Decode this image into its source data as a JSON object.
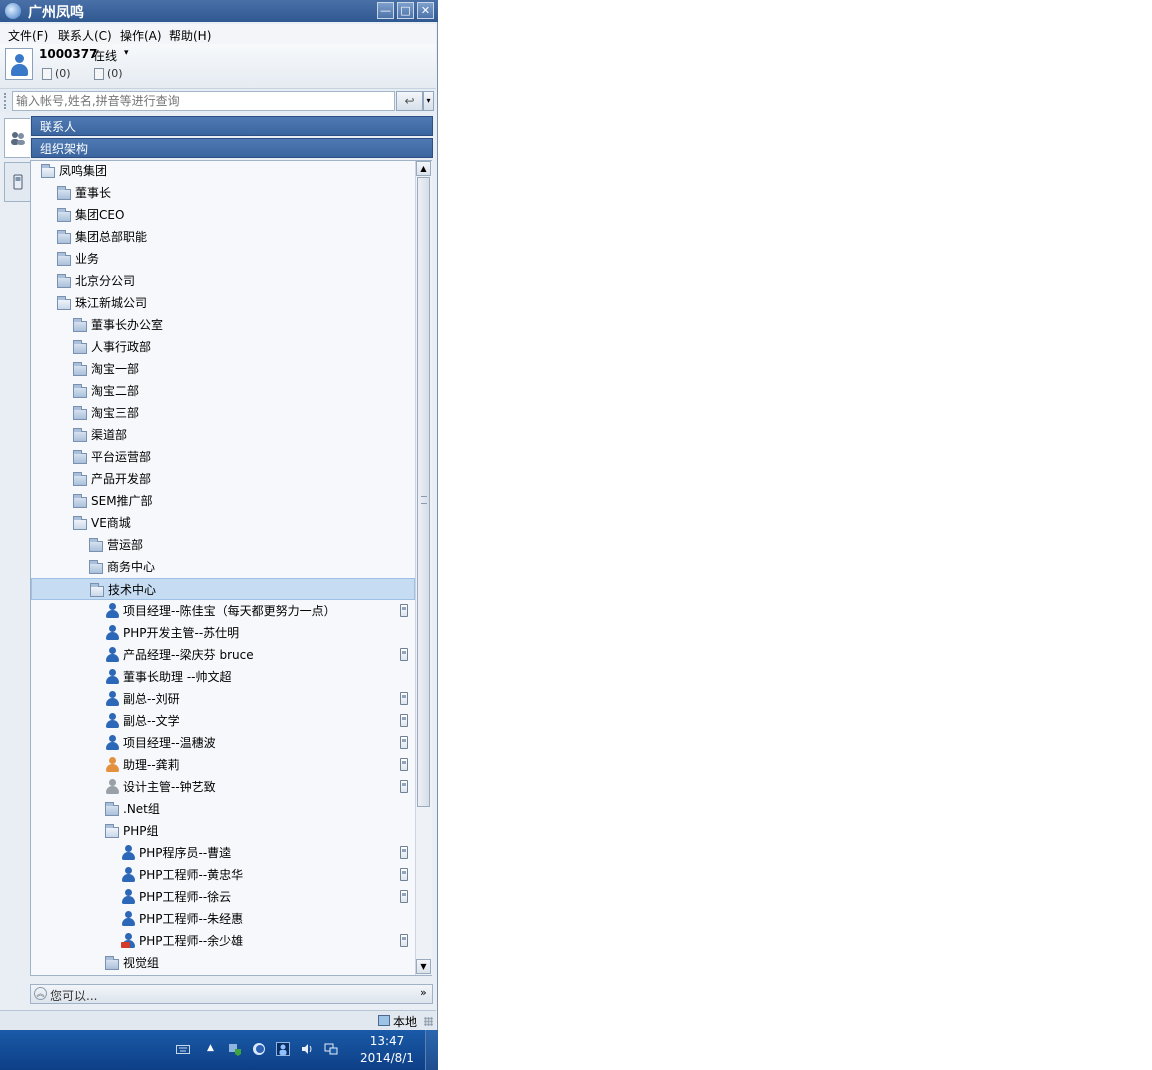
{
  "window": {
    "title": "广州凤鸣",
    "minimize_glyph": "—",
    "maximize_glyph": "□",
    "close_glyph": "✕"
  },
  "menu": [
    "文件(F)",
    "联系人(C)",
    "操作(A)",
    "帮助(H)"
  ],
  "user": {
    "id": "1000377",
    "status": "在线",
    "status_caret": "▾",
    "msg_count_1": "(0)",
    "msg_count_2": "(0)"
  },
  "search": {
    "placeholder": "输入帐号,姓名,拼音等进行查询",
    "button_glyph": "↩",
    "dropdown_glyph": "▾"
  },
  "headers": {
    "contacts": "联系人",
    "org": "组织架构"
  },
  "tree": [
    {
      "label": "凤鸣集团",
      "type": "folder",
      "open": true,
      "level": 0
    },
    {
      "label": "董事长",
      "type": "folder",
      "level": 1
    },
    {
      "label": "集团CEO",
      "type": "folder",
      "level": 1
    },
    {
      "label": "集团总部职能",
      "type": "folder",
      "level": 1
    },
    {
      "label": "业务",
      "type": "folder",
      "level": 1
    },
    {
      "label": "北京分公司",
      "type": "folder",
      "level": 1
    },
    {
      "label": "珠江新城公司",
      "type": "folder",
      "open": true,
      "level": 1
    },
    {
      "label": "董事长办公室",
      "type": "folder",
      "level": 2
    },
    {
      "label": "人事行政部",
      "type": "folder",
      "level": 2
    },
    {
      "label": "淘宝一部",
      "type": "folder",
      "level": 2
    },
    {
      "label": "淘宝二部",
      "type": "folder",
      "level": 2
    },
    {
      "label": "淘宝三部",
      "type": "folder",
      "level": 2
    },
    {
      "label": "渠道部",
      "type": "folder",
      "level": 2
    },
    {
      "label": "平台运营部",
      "type": "folder",
      "level": 2
    },
    {
      "label": "产品开发部",
      "type": "folder",
      "level": 2
    },
    {
      "label": "SEM推广部",
      "type": "folder",
      "level": 2
    },
    {
      "label": "VE商城",
      "type": "folder",
      "open": true,
      "level": 2
    },
    {
      "label": "营运部",
      "type": "folder",
      "level": 3
    },
    {
      "label": "商务中心",
      "type": "folder",
      "level": 3
    },
    {
      "label": "技术中心",
      "type": "folder",
      "open": true,
      "level": 3,
      "selected": true
    },
    {
      "label": "项目经理--陈佳宝（每天都更努力一点）",
      "type": "person",
      "color": "blue",
      "phone": true,
      "level": 4
    },
    {
      "label": "PHP开发主管--苏仕明",
      "type": "person",
      "color": "blue",
      "level": 4
    },
    {
      "label": "产品经理--梁庆芬 bruce",
      "type": "person",
      "color": "blue",
      "phone": true,
      "level": 4
    },
    {
      "label": "董事长助理 --帅文超",
      "type": "person",
      "color": "blue",
      "level": 4
    },
    {
      "label": "副总--刘研",
      "type": "person",
      "color": "blue",
      "phone": true,
      "level": 4
    },
    {
      "label": "副总--文学",
      "type": "person",
      "color": "blue",
      "phone": true,
      "level": 4
    },
    {
      "label": "项目经理--温穗波",
      "type": "person",
      "color": "blue",
      "phone": true,
      "level": 4
    },
    {
      "label": "助理--龚莉",
      "type": "person",
      "color": "orange",
      "phone": true,
      "level": 4
    },
    {
      "label": "设计主管--钟艺致",
      "type": "person",
      "color": "gray",
      "phone": true,
      "level": 4
    },
    {
      "label": ".Net组",
      "type": "folder",
      "level": 4
    },
    {
      "label": "PHP组",
      "type": "folder",
      "open": true,
      "level": 4
    },
    {
      "label": "PHP程序员--曹逵",
      "type": "person",
      "color": "blue",
      "phone": true,
      "level": 5
    },
    {
      "label": "PHP工程师--黄忠华",
      "type": "person",
      "color": "blue",
      "phone": true,
      "level": 5
    },
    {
      "label": "PHP工程师--徐云",
      "type": "person",
      "color": "blue",
      "phone": true,
      "level": 5
    },
    {
      "label": "PHP工程师--朱经惠",
      "type": "person",
      "color": "blue",
      "level": 5
    },
    {
      "label": "PHP工程师--余少雄",
      "type": "person",
      "color": "blue",
      "phone": true,
      "badge": true,
      "level": 5
    },
    {
      "label": "视觉组",
      "type": "folder",
      "level": 4
    }
  ],
  "scroll_glyphs": {
    "up": "▲",
    "down": "▼"
  },
  "youcan": {
    "icon_glyph": "︽",
    "text": "您可以...",
    "more_glyph": "»"
  },
  "statusbar": {
    "local": "本地"
  },
  "taskbar": {
    "time": "13:47",
    "date": "2014/8/1",
    "tray_arrow": "▲"
  },
  "colors": {
    "title_bar": "#2f5891",
    "header_bar": "#3a65a0",
    "selected_row": "#c5dcf3",
    "taskbar": "#0d3f86"
  }
}
